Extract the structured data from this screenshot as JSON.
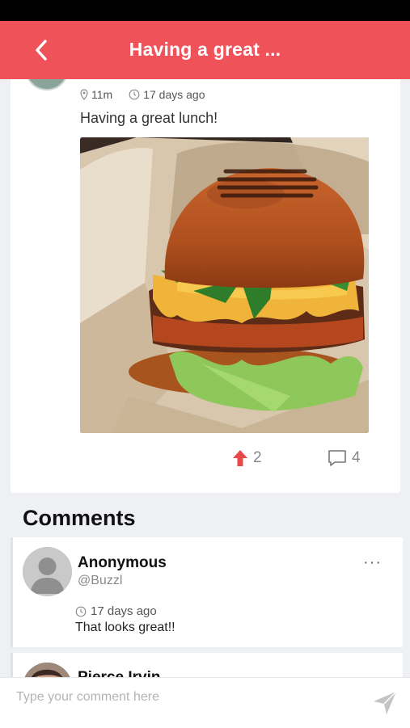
{
  "header": {
    "title": "Having a great ..."
  },
  "post": {
    "distance": "11m",
    "time_ago": "17 days ago",
    "text": "Having a great lunch!",
    "image_alt": "burger photo",
    "upvotes": "2",
    "comments": "4"
  },
  "comments_section": {
    "title": "Comments",
    "items": [
      {
        "name": "Anonymous",
        "handle": "@Buzzl",
        "time_ago": "17 days ago",
        "text": "That looks great!!",
        "more": "···"
      },
      {
        "name": "Pierce Irvin"
      }
    ]
  },
  "composer": {
    "placeholder": "Type your comment here"
  },
  "colors": {
    "accent": "#f0525a",
    "upvote": "#e94848"
  },
  "icons": {
    "back": "chevron-left-icon",
    "location": "location-pin-icon",
    "clock": "clock-icon",
    "upvote": "arrow-up-icon",
    "comment": "comment-bubble-icon",
    "send": "send-icon"
  }
}
